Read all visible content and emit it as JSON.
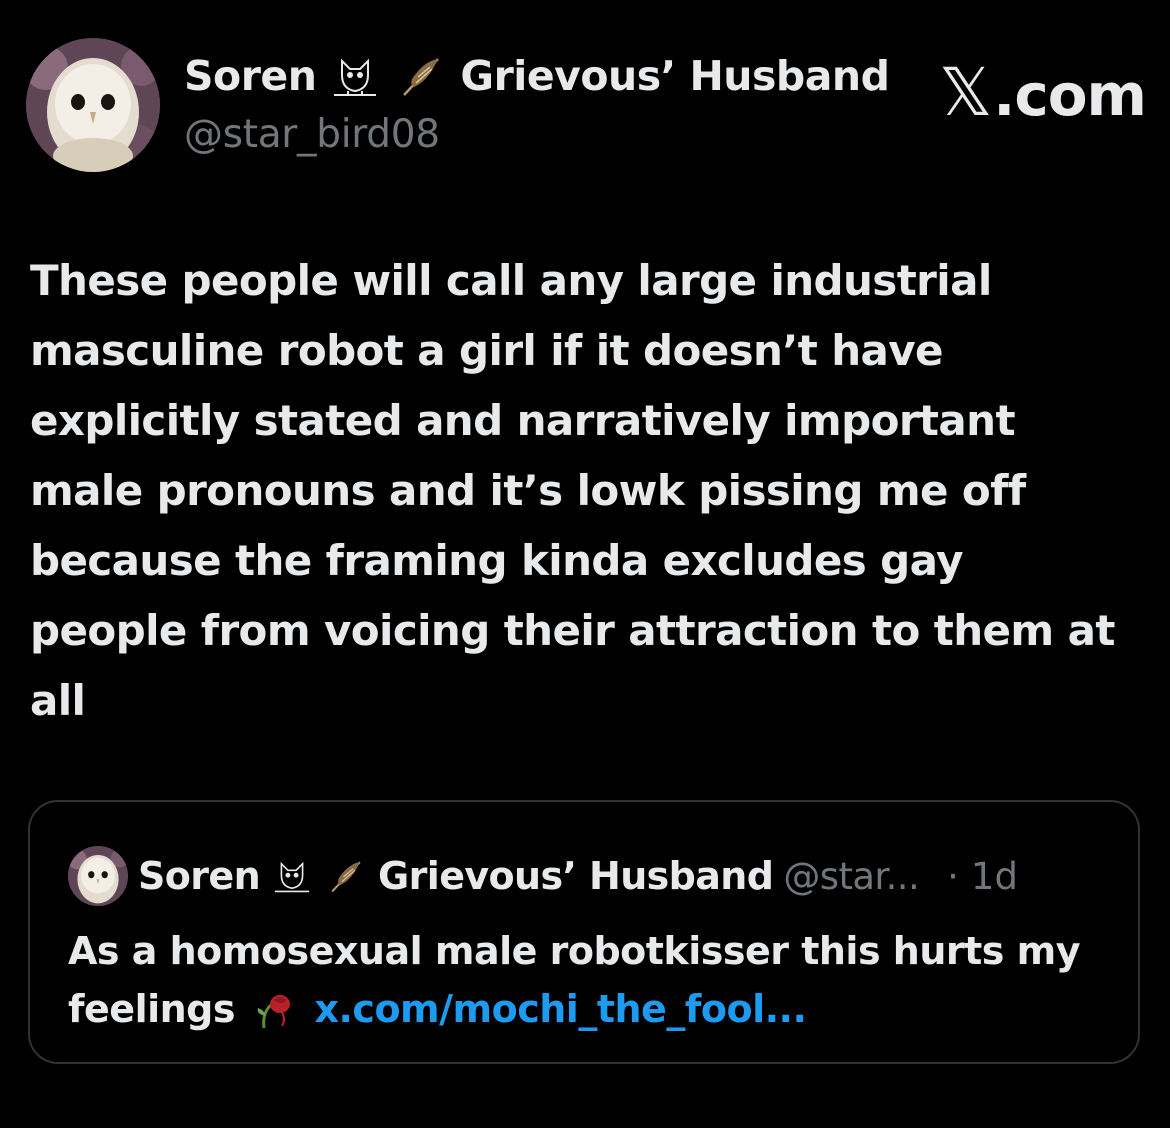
{
  "author": {
    "name_first": "Soren",
    "name_second": "Grievous’ Husband",
    "handle": "@star_bird08",
    "emoji_1": "owl-emoji",
    "emoji_2": "feather-emoji"
  },
  "brand": {
    "logo": "𝕏",
    "domain": ".com"
  },
  "tweet": {
    "text": "These people will call any large industrial masculine robot a girl if it doesn’t have explicitly stated and narratively important male pronouns and it’s lowk pissing me off because the framing kinda excludes gay people from voicing their attraction to them at all"
  },
  "quote": {
    "name_first": "Soren",
    "name_second": "Grievous’ Husband",
    "handle_truncated": "@star...",
    "separator": "·",
    "time": "1d",
    "text_before": "As a homosexual male robotkisser this hurts my feelings",
    "emoji": "wilted-rose-emoji",
    "link": "x.com/mochi_the_fool..."
  },
  "colors": {
    "background": "#000000",
    "primary_text": "#e7e9ea",
    "secondary_text": "#71767b",
    "link": "#1d9bf0",
    "border": "#2f3336"
  }
}
